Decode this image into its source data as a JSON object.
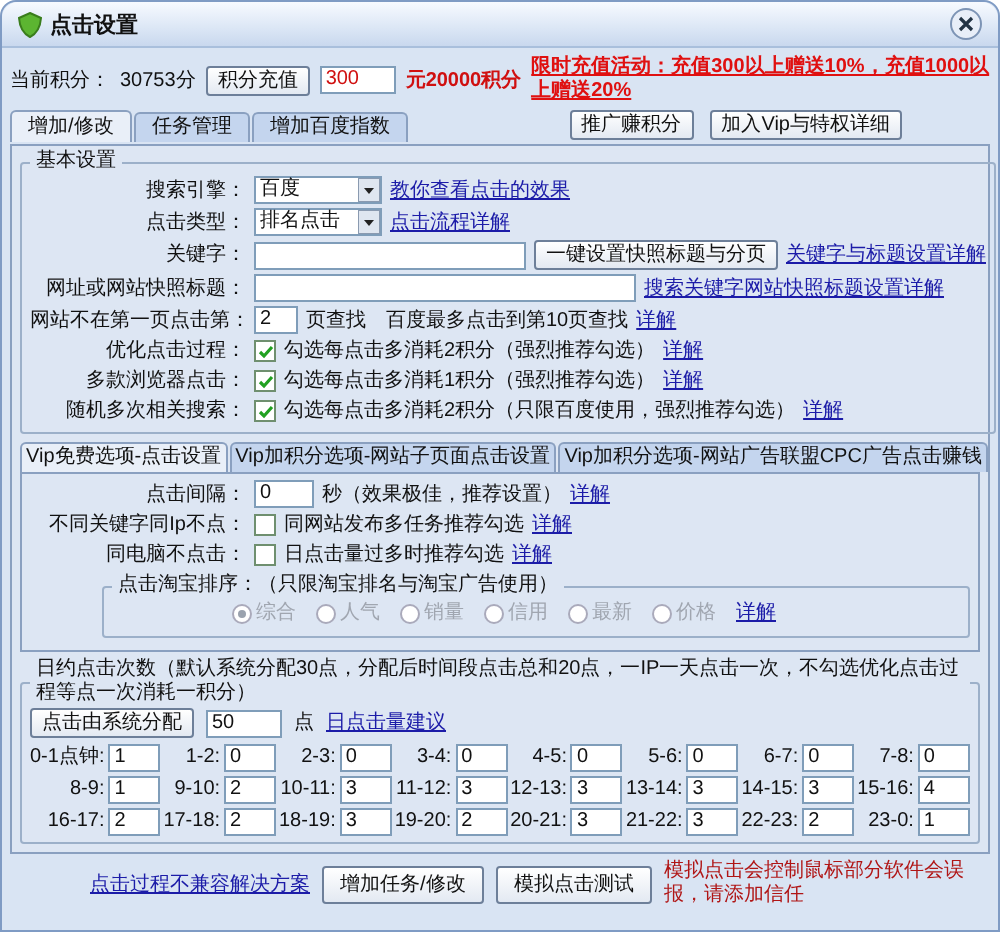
{
  "window": {
    "title": "点击设置"
  },
  "header": {
    "points_label": "当前积分：",
    "points_value": "30753分",
    "recharge_button": "积分充值",
    "amount": "300",
    "rate": "元20000积分",
    "promo": "限时充值活动：充值300以上赠送10%，充值1000以上赠送20%",
    "buttons": [
      "推广赚积分",
      "加入Vip与特权详细"
    ]
  },
  "tabs": [
    {
      "label": "增加/修改",
      "selected": true
    },
    {
      "label": "任务管理",
      "selected": false
    },
    {
      "label": "增加百度指数",
      "selected": false
    }
  ],
  "basic": {
    "title": "基本设置",
    "engine": {
      "label": "搜索引擎：",
      "value": "百度",
      "link": "教你查看点击的效果"
    },
    "click_type": {
      "label": "点击类型：",
      "value": "排名点击",
      "link": "点击流程详解"
    },
    "keyword": {
      "label": "关键字：",
      "button": "一键设置快照标题与分页",
      "link": "关键字与标题设置详解"
    },
    "url_title": {
      "label": "网址或网站快照标题：",
      "link": "搜索关键字网站快照标题设置详解"
    },
    "page": {
      "label": "网站不在第一页点击第：",
      "value": "2",
      "unit": "页查找",
      "note": "百度最多点击到第10页查找",
      "link": "详解"
    },
    "options": [
      {
        "label": "优化点击过程：",
        "checked": true,
        "text": "勾选每点击多消耗2积分（强烈推荐勾选）",
        "link": "详解"
      },
      {
        "label": "多款浏览器点击：",
        "checked": true,
        "text": "勾选每点击多消耗1积分（强烈推荐勾选）",
        "link": "详解"
      },
      {
        "label": "随机多次相关搜索：",
        "checked": true,
        "text": "勾选每点击多消耗2积分（只限百度使用，强烈推荐勾选）",
        "link": "详解"
      }
    ]
  },
  "vip_tabs": [
    {
      "label": "Vip免费选项-点击设置",
      "selected": true
    },
    {
      "label": "Vip加积分选项-网站子页面点击设置",
      "selected": false
    },
    {
      "label": "Vip加积分选项-网站广告联盟CPC广告点击赚钱",
      "selected": false
    }
  ],
  "vip": {
    "interval": {
      "label": "点击间隔：",
      "value": "0",
      "note": "秒（效果极佳，推荐设置）",
      "link": "详解"
    },
    "options": [
      {
        "label": "不同关键字同Ip不点：",
        "checked": false,
        "text": "同网站发布多任务推荐勾选",
        "link": "详解"
      },
      {
        "label": "同电脑不点击：",
        "checked": false,
        "text": "日点击量过多时推荐勾选",
        "link": "详解"
      }
    ],
    "taobao": {
      "title": "点击淘宝排序：（只限淘宝排名与淘宝广告使用）",
      "disabled": true,
      "choices": [
        {
          "label": "综合",
          "selected": true
        },
        {
          "label": "人气",
          "selected": false
        },
        {
          "label": "销量",
          "selected": false
        },
        {
          "label": "信用",
          "selected": false
        },
        {
          "label": "最新",
          "selected": false
        },
        {
          "label": "价格",
          "selected": false
        }
      ],
      "link": "详解"
    }
  },
  "daily": {
    "title": "日约点击次数（默认系统分配30点，分配后时间段点击总和20点，一IP一天点击一次，不勾选优化点击过程等点一次消耗一积分）",
    "button": "点击由系统分配",
    "value": "50",
    "unit": "点",
    "link": "日点击量建议",
    "hours": [
      {
        "label": "0-1点钟:",
        "value": "1"
      },
      {
        "label": "1-2:",
        "value": "0"
      },
      {
        "label": "2-3:",
        "value": "0"
      },
      {
        "label": "3-4:",
        "value": "0"
      },
      {
        "label": "4-5:",
        "value": "0"
      },
      {
        "label": "5-6:",
        "value": "0"
      },
      {
        "label": "6-7:",
        "value": "0"
      },
      {
        "label": "7-8:",
        "value": "0"
      },
      {
        "label": "8-9:",
        "value": "1"
      },
      {
        "label": "9-10:",
        "value": "2"
      },
      {
        "label": "10-11:",
        "value": "3"
      },
      {
        "label": "11-12:",
        "value": "3"
      },
      {
        "label": "12-13:",
        "value": "3"
      },
      {
        "label": "13-14:",
        "value": "3"
      },
      {
        "label": "14-15:",
        "value": "3"
      },
      {
        "label": "15-16:",
        "value": "4"
      },
      {
        "label": "16-17:",
        "value": "2"
      },
      {
        "label": "17-18:",
        "value": "2"
      },
      {
        "label": "18-19:",
        "value": "3"
      },
      {
        "label": "19-20:",
        "value": "2"
      },
      {
        "label": "20-21:",
        "value": "3"
      },
      {
        "label": "21-22:",
        "value": "3"
      },
      {
        "label": "22-23:",
        "value": "2"
      },
      {
        "label": "23-0:",
        "value": "1"
      }
    ]
  },
  "footer": {
    "link": "点击过程不兼容解决方案",
    "buttons": [
      "增加任务/修改",
      "模拟点击测试"
    ],
    "warning": "模拟点击会控制鼠标部分软件会误报，请添加信任"
  }
}
